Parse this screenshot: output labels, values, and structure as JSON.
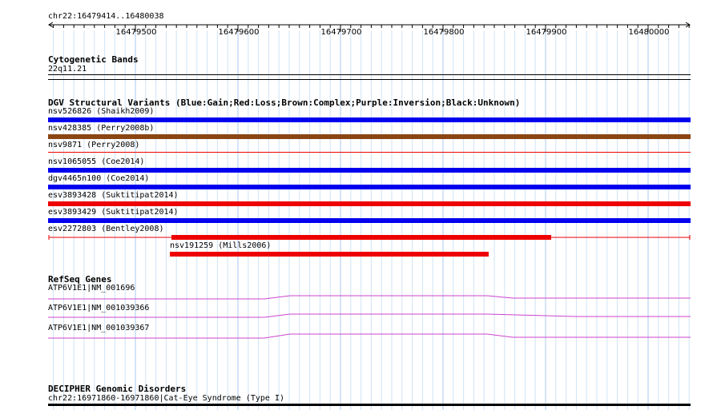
{
  "ruler": {
    "coordinates": "chr22:16479414..16480038",
    "ticks": [
      "16479500",
      "16479600",
      "16479700",
      "16479800",
      "16479900",
      "16480000"
    ]
  },
  "cytoband": {
    "title": "Cytogenetic Bands",
    "band": "22q11.21"
  },
  "dgv": {
    "title": "DGV Structural Variants (Blue:Gain;Red:Loss;Brown:Complex;Purple:Inversion;Black:Unknown)",
    "legend_colors": {
      "gain": "#0000ee",
      "loss": "#ee0000",
      "complex": "#8b4513"
    },
    "variants": [
      {
        "label": "nsv526826 (Shaikh2009)",
        "type": "gain"
      },
      {
        "label": "nsv428385 (Perry2008b)",
        "type": "complex"
      },
      {
        "label": "nsv9871 (Perry2008)",
        "type": "loss"
      },
      {
        "label": "nsv1065055 (Coe2014)",
        "type": "gain"
      },
      {
        "label": "dgv4465n100 (Coe2014)",
        "type": "gain"
      },
      {
        "label": "esv3893428 (Suktitipat2014)",
        "type": "loss"
      },
      {
        "label": "esv3893429 (Suktitipat2014)",
        "type": "gain"
      },
      {
        "label": "esv2272803 (Bentley2008)",
        "type": "loss"
      },
      {
        "label": "nsv191259 (Mills2006)",
        "type": "loss"
      }
    ]
  },
  "refseq": {
    "title": "RefSeq Genes",
    "line_color": "#cc44cc",
    "genes": [
      {
        "label": "ATP6V1E1|NM_001696"
      },
      {
        "label": "ATP6V1E1|NM_001039366"
      },
      {
        "label": "ATP6V1E1|NM_001039367"
      }
    ]
  },
  "decipher": {
    "title": "DECIPHER Genomic Disorders",
    "entry": "chr22:16971860-16971860|Cat-Eye Syndrome (Type I)"
  }
}
